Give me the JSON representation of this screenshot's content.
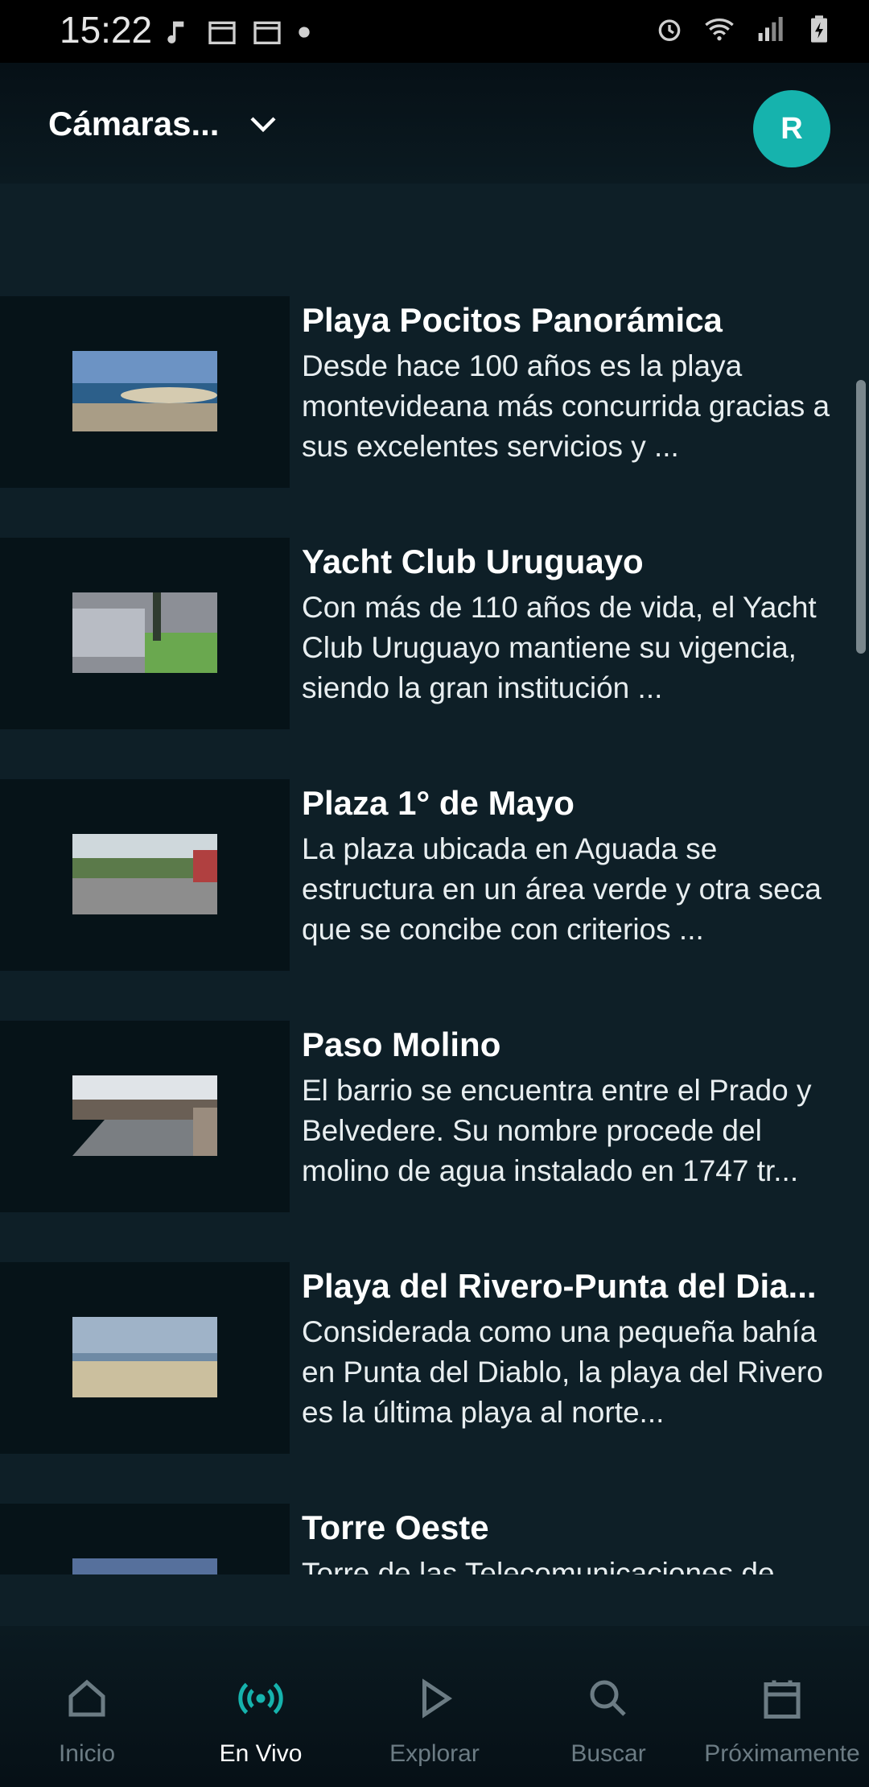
{
  "status_bar": {
    "time": "15:22",
    "left_icons": [
      "music-note-icon",
      "calendar-icon",
      "calendar-icon",
      "dot-icon"
    ],
    "right_icons": [
      "alarm-icon",
      "wifi-icon",
      "signal-icon",
      "battery-charging-icon"
    ]
  },
  "header": {
    "title": "Cámaras...",
    "dropdown_icon": "chevron-down-icon",
    "avatar_initial": "R",
    "avatar_color": "#16b3ad"
  },
  "cameras": [
    {
      "title": "Playa Pocitos Panorámica",
      "description": "Desde hace 100 años es la playa montevideana más concurrida gracias a sus excelentes servicios y ..."
    },
    {
      "title": "Yacht Club Uruguayo",
      "description": "Con más de 110 años de vida, el Yacht Club Uruguayo mantiene su vigencia, siendo la gran institución ..."
    },
    {
      "title": "Plaza 1° de Mayo",
      "description": "La plaza ubicada en Aguada se estructura en un área verde y otra seca que se concibe con criterios ..."
    },
    {
      "title": "Paso Molino",
      "description": "El barrio se encuentra entre el Prado y Belvedere. Su nombre procede del molino de agua instalado en 1747 tr..."
    },
    {
      "title": "Playa del Rivero-Punta del Dia...",
      "description": "Considerada como una pequeña bahía en Punta del Diablo, la playa del Rivero es la última playa al norte..."
    },
    {
      "title": "Torre Oeste",
      "description": "Torre de las Telecomunicaciones de"
    }
  ],
  "bottom_nav": {
    "active": "En Vivo",
    "items": [
      {
        "label": "Inicio",
        "icon": "home-icon"
      },
      {
        "label": "En Vivo",
        "icon": "live-broadcast-icon"
      },
      {
        "label": "Explorar",
        "icon": "play-icon"
      },
      {
        "label": "Buscar",
        "icon": "search-icon"
      },
      {
        "label": "Próximamente",
        "icon": "calendar-icon"
      }
    ]
  },
  "colors": {
    "background": "#0e1f27",
    "accent": "#16b3ad",
    "inactive_nav": "#6c7c84"
  }
}
